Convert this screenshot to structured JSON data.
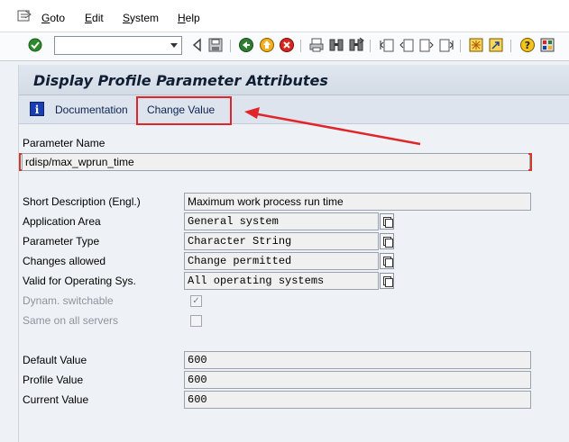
{
  "menubar": {
    "items": [
      {
        "label": "Goto",
        "u": "G",
        "rest": "oto"
      },
      {
        "label": "Edit",
        "u": "E",
        "rest": "dit"
      },
      {
        "label": "System",
        "u": "S",
        "rest": "ystem"
      },
      {
        "label": "Help",
        "u": "H",
        "rest": "elp"
      }
    ]
  },
  "toolbar": {
    "command_field": {
      "value": "",
      "placeholder": ""
    },
    "icons": [
      "enter-icon",
      "back-icon",
      "save-icon",
      "back-green-icon",
      "exit-icon",
      "cancel-icon",
      "print-icon",
      "find-icon",
      "find-next-icon",
      "first-page-icon",
      "previous-page-icon",
      "next-page-icon",
      "last-page-icon",
      "create-session-icon",
      "shortcut-icon",
      "help-icon",
      "customize-layout-icon"
    ]
  },
  "screen": {
    "title": "Display Profile Parameter Attributes",
    "app_toolbar": {
      "documentation": "Documentation",
      "change_value": "Change Value"
    }
  },
  "form": {
    "parameter_name": {
      "label": "Parameter Name",
      "value": "rdisp/max_wprun_time"
    },
    "short_description": {
      "label": "Short Description (Engl.)",
      "value": "Maximum work process run time"
    },
    "application_area": {
      "label": "Application Area",
      "value": "General system"
    },
    "parameter_type": {
      "label": "Parameter Type",
      "value": "Character String"
    },
    "changes_allowed": {
      "label": "Changes allowed",
      "value": "Change permitted"
    },
    "valid_os": {
      "label": "Valid for Operating Sys.",
      "value": "All operating systems"
    },
    "dynam_switchable": {
      "label": "Dynam. switchable",
      "checked": true
    },
    "same_on_all_servers": {
      "label": "Same on all servers",
      "checked": false
    },
    "default_value": {
      "label": "Default Value",
      "value": "600"
    },
    "profile_value": {
      "label": "Profile Value",
      "value": "600"
    },
    "current_value": {
      "label": "Current Value",
      "value": "600"
    }
  },
  "colors": {
    "highlight": "#e0262b",
    "title_text": "#101f33",
    "background": "#eef2f6"
  }
}
